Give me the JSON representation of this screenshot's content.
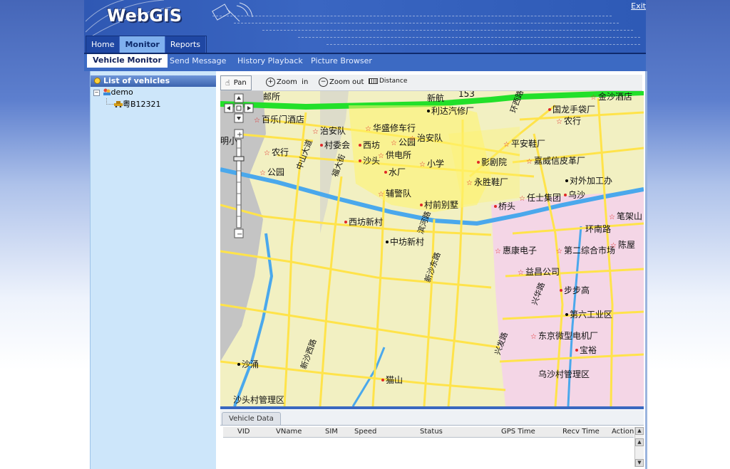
{
  "app": {
    "logo": "WebGIS",
    "exit_label": "Exit"
  },
  "nav": {
    "tabs": [
      {
        "label": "Home",
        "active": false
      },
      {
        "label": "Monitor",
        "active": true
      },
      {
        "label": "Reports",
        "active": false
      }
    ]
  },
  "subnav": {
    "tabs": [
      {
        "label": "Vehicle Monitor",
        "active": true
      },
      {
        "label": "Send Message",
        "active": false
      },
      {
        "label": "History Playback",
        "active": false
      },
      {
        "label": "Picture Browser",
        "active": false
      }
    ]
  },
  "sidebar": {
    "title": "List of vehicles",
    "tree": {
      "group": "demo",
      "vehicle": "粤B12321"
    }
  },
  "toolbar": {
    "pan": "Pan",
    "zoom_in": "Zoom  in",
    "zoom_out": "Zoom out",
    "distance": "Distance"
  },
  "map": {
    "labels": [
      {
        "text": "百乐门酒店"
      },
      {
        "text": "治安队"
      },
      {
        "text": "华盛修车行"
      },
      {
        "text": "利达汽修厂"
      },
      {
        "text": "国龙手袋厂"
      },
      {
        "text": "金沙酒店"
      },
      {
        "text": "农行"
      },
      {
        "text": "村委会"
      },
      {
        "text": "西坊"
      },
      {
        "text": "公园"
      },
      {
        "text": "治安队"
      },
      {
        "text": "平安鞋厂"
      },
      {
        "text": "农行"
      },
      {
        "text": "沙头"
      },
      {
        "text": "供电所"
      },
      {
        "text": "小学"
      },
      {
        "text": "影剧院"
      },
      {
        "text": "嘉威信皮革厂"
      },
      {
        "text": "公园"
      },
      {
        "text": "水厂"
      },
      {
        "text": "永胜鞋厂"
      },
      {
        "text": "对外加工办"
      },
      {
        "text": "辅警队"
      },
      {
        "text": "乌沙"
      },
      {
        "text": "任士集团"
      },
      {
        "text": "村前别墅"
      },
      {
        "text": "桥头"
      },
      {
        "text": "笔架山"
      },
      {
        "text": "西坊新村"
      },
      {
        "text": "环南路"
      },
      {
        "text": "中坊新村"
      },
      {
        "text": "惠康电子"
      },
      {
        "text": "第二综合市场"
      },
      {
        "text": "陈屋"
      },
      {
        "text": "益昌公司"
      },
      {
        "text": "步步高"
      },
      {
        "text": "第六工业区"
      },
      {
        "text": "东京微型电机厂"
      },
      {
        "text": "宝裕"
      },
      {
        "text": "沙涌"
      },
      {
        "text": "乌沙村管理区"
      },
      {
        "text": "猫山"
      },
      {
        "text": "沙头村管理区"
      },
      {
        "text": "明小"
      },
      {
        "text": "中山大道"
      },
      {
        "text": "福大街"
      },
      {
        "text": "滨河路"
      },
      {
        "text": "新沙东路"
      },
      {
        "text": "新沙西路"
      },
      {
        "text": "兴华路"
      },
      {
        "text": "兴发路"
      },
      {
        "text": "环西路"
      },
      {
        "text": "新航"
      },
      {
        "text": "邮所"
      },
      {
        "text": "153"
      }
    ]
  },
  "bottom": {
    "tab": "Vehicle Data",
    "columns": [
      "VID",
      "VName",
      "SIM",
      "Speed",
      "Status",
      "GPS Time",
      "Recv Time",
      "Action"
    ]
  },
  "colors": {
    "header": "#3a66c2",
    "sidebar": "#cde6fa",
    "map_base": "#f2f0c2",
    "river": "#4aa8ec",
    "road": "#ffe34a",
    "highway": "#22e02a"
  }
}
